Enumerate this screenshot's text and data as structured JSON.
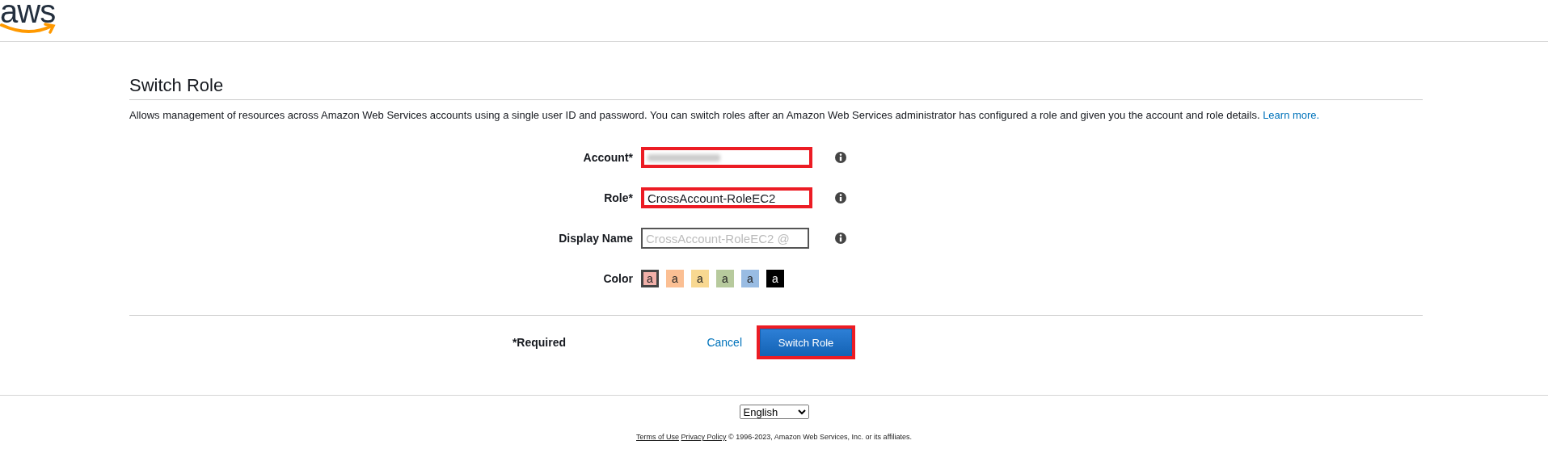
{
  "header": {
    "logo": "aws"
  },
  "title": "Switch Role",
  "description": {
    "text": "Allows management of resources across Amazon Web Services accounts using a single user ID and password. You can switch roles after an Amazon Web Services administrator has configured a role and given you the account and role details.",
    "link": "Learn more."
  },
  "fields": [
    {
      "label": "Account*",
      "kind": "redacted",
      "highlighted": true
    },
    {
      "label": "Role*",
      "kind": "value",
      "value": "CrossAccount-RoleEC2",
      "highlighted": true
    },
    {
      "label": "Display Name",
      "kind": "placeholder",
      "placeholder": "CrossAccount-RoleEC2 @",
      "highlighted": false
    }
  ],
  "color": {
    "label": "Color",
    "swatches": [
      {
        "letter": "a",
        "color": "#f2b0a9",
        "selected": true
      },
      {
        "letter": "a",
        "color": "#fbbf93",
        "selected": false
      },
      {
        "letter": "a",
        "color": "#f8d891",
        "selected": false
      },
      {
        "letter": "a",
        "color": "#b7ca9d",
        "selected": false
      },
      {
        "letter": "a",
        "color": "#99bce3",
        "selected": false
      },
      {
        "letter": "a",
        "color": "#000000",
        "selected": false
      }
    ]
  },
  "required_note": "*Required",
  "cancel": "Cancel",
  "submit": {
    "label": "Switch Role",
    "highlighted": true
  },
  "footer": {
    "language": "English",
    "links": [
      "Terms of Use",
      "Privacy Policy"
    ],
    "copyright": "© 1996-2023, Amazon Web Services, Inc. or its affiliates."
  }
}
